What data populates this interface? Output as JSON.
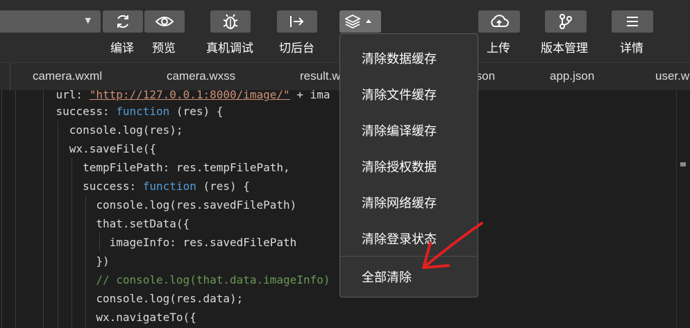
{
  "toolbar": {
    "mode_select": {
      "value": ""
    },
    "compile_label": "编译",
    "preview_label": "预览",
    "remote_debug_label": "真机调试",
    "background_label": "切后台",
    "upload_label": "上传",
    "version_label": "版本管理",
    "details_label": "详情"
  },
  "tabs": [
    {
      "label": "camera.wxml"
    },
    {
      "label": "camera.wxss"
    },
    {
      "label": "result.w"
    },
    {
      "label": "json"
    },
    {
      "label": "app.json"
    },
    {
      "label": "user.w"
    }
  ],
  "code": {
    "line1": {
      "indent": "    ",
      "prefix": "url: ",
      "string": "\"http://127.0.0.1:8000/image/\"",
      "suffix": " + ima"
    },
    "line2": {
      "indent": "    ",
      "prefix": "success: ",
      "keyword": "function",
      "suffix": " (res) {"
    },
    "line3": {
      "text": "      console.log(res);"
    },
    "line4": {
      "text": "      wx.saveFile({"
    },
    "line5": {
      "text": "        tempFilePath: res.tempFilePath,"
    },
    "line6": {
      "indent": "        ",
      "prefix": "success: ",
      "keyword": "function",
      "suffix": " (res) {"
    },
    "line7": {
      "text": "          console.log(res.savedFilePath)"
    },
    "line8": {
      "text": "          that.setData({"
    },
    "line9": {
      "text": "            imageInfo: res.savedFilePath"
    },
    "line10": {
      "text": "          })"
    },
    "line11": {
      "text": "          // console.log(that.data.imageInfo)"
    },
    "line12": {
      "text": "          console.log(res.data);"
    },
    "line13": {
      "text": "          wx.navigateTo({"
    },
    "trailing": ","
  },
  "cache_menu": {
    "items": [
      {
        "label": "清除数据缓存"
      },
      {
        "label": "清除文件缓存"
      },
      {
        "label": "清除编译缓存"
      },
      {
        "label": "清除授权数据"
      },
      {
        "label": "清除网络缓存"
      },
      {
        "label": "清除登录状态"
      }
    ],
    "clear_all_label": "全部清除"
  },
  "annotation": {
    "color": "#e02020"
  }
}
